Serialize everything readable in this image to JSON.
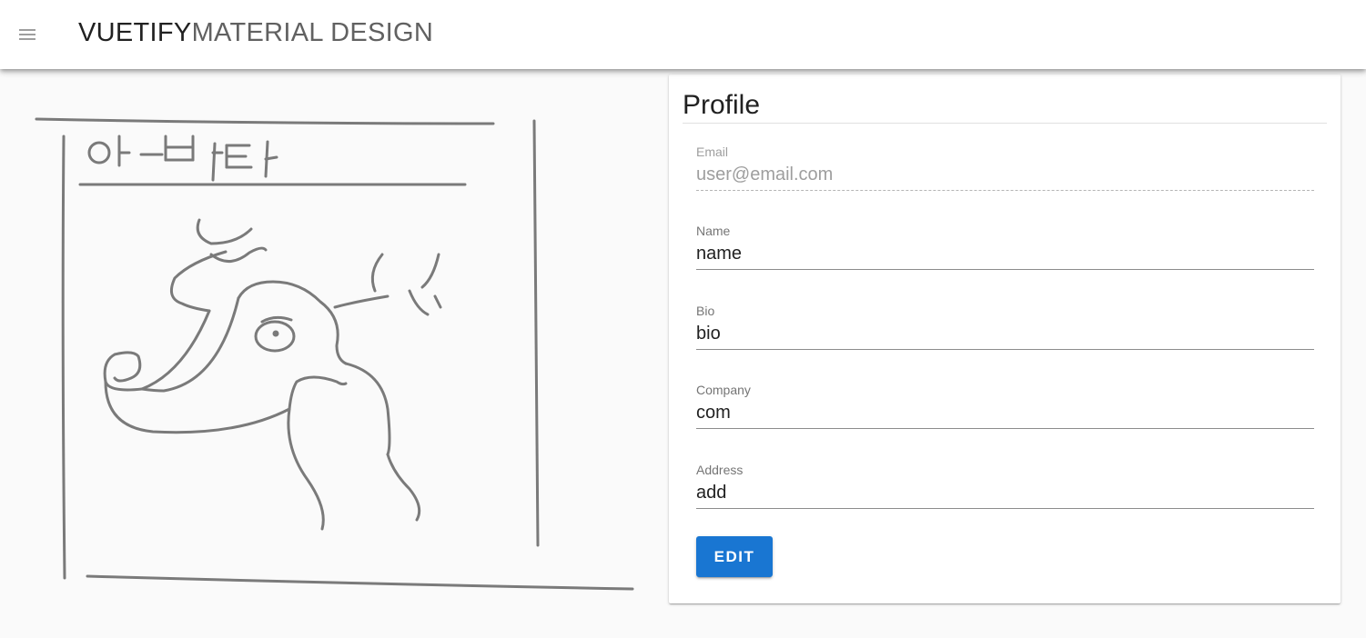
{
  "toolbar": {
    "brand_bold": "VUETIFY",
    "brand_light": "MATERIAL DESIGN",
    "menu_icon": "hamburger-menu-icon"
  },
  "avatar": {
    "kind": "hand-drawn sketch",
    "handwritten_text": "아바타"
  },
  "profile": {
    "title": "Profile",
    "fields": [
      {
        "label": "Email",
        "value": "user@email.com",
        "disabled": true
      },
      {
        "label": "Name",
        "value": "name",
        "disabled": false
      },
      {
        "label": "Bio",
        "value": "bio",
        "disabled": false
      },
      {
        "label": "Company",
        "value": "com",
        "disabled": false
      },
      {
        "label": "Address",
        "value": "add",
        "disabled": false
      }
    ],
    "edit_label": "EDIT"
  },
  "colors": {
    "primary": "#1976d2",
    "background": "#fafafa"
  }
}
